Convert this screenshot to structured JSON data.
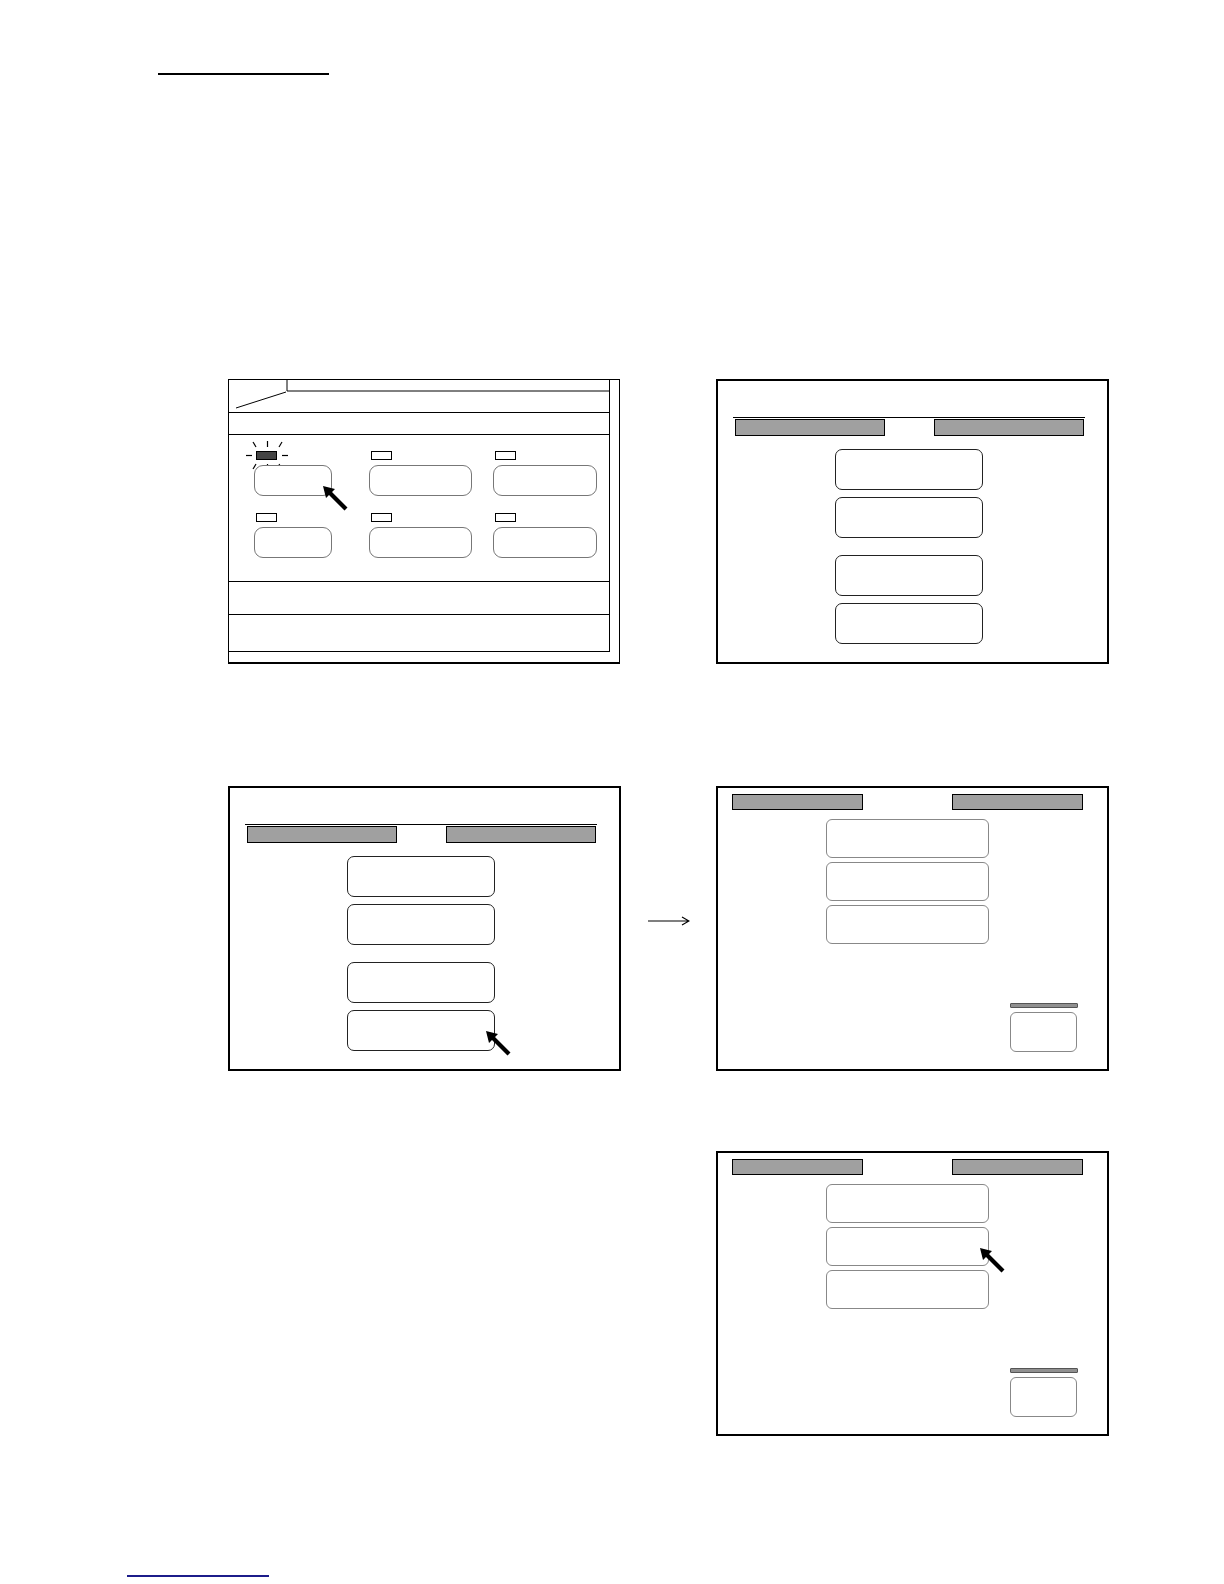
{
  "screens": [
    {
      "kind": "menu",
      "items": [
        {
          "lamp_on": true,
          "pointed": true
        },
        {
          "lamp_on": false,
          "pointed": false
        },
        {
          "lamp_on": false,
          "pointed": false
        },
        {
          "lamp_on": false,
          "pointed": false
        },
        {
          "lamp_on": false,
          "pointed": false
        },
        {
          "lamp_on": false,
          "pointed": false
        }
      ]
    },
    {
      "kind": "choice",
      "groups": [
        {
          "buttons": [
            {
              "pointed": false
            },
            {
              "pointed": false
            }
          ]
        },
        {
          "buttons": [
            {
              "pointed": false
            },
            {
              "pointed": false
            }
          ]
        }
      ]
    },
    {
      "kind": "choice",
      "groups": [
        {
          "buttons": [
            {
              "pointed": false
            },
            {
              "pointed": false
            }
          ]
        },
        {
          "buttons": [
            {
              "pointed": false
            },
            {
              "pointed": true
            }
          ]
        }
      ],
      "arrow_after": true
    },
    {
      "kind": "list",
      "buttons": [
        {
          "pointed": false
        },
        {
          "pointed": false
        },
        {
          "pointed": false
        }
      ]
    },
    {
      "kind": "list",
      "buttons": [
        {
          "pointed": false
        },
        {
          "pointed": true
        },
        {
          "pointed": false
        }
      ]
    }
  ]
}
